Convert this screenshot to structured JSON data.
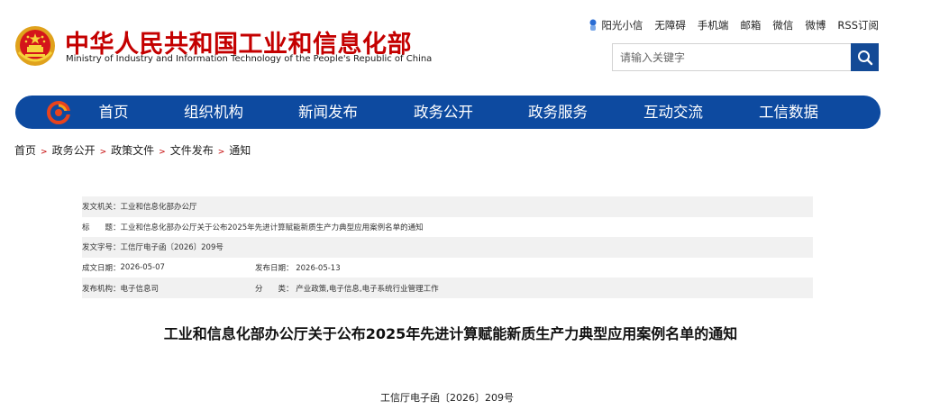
{
  "header": {
    "title_cn": "中华人民共和国工业和信息化部",
    "title_en": "Ministry of Industry and Information Technology of the People's Republic of China",
    "top_links": [
      "阳光小信",
      "无障碍",
      "手机端",
      "邮箱",
      "微信",
      "微博",
      "RSS订阅"
    ],
    "search_placeholder": "请输入关键字"
  },
  "nav": {
    "items": [
      "首页",
      "组织机构",
      "新闻发布",
      "政务公开",
      "政务服务",
      "互动交流",
      "工信数据"
    ],
    "color": "#0d4aa0"
  },
  "breadcrumb": [
    "首页",
    "政务公开",
    "政策文件",
    "文件发布",
    "通知"
  ],
  "info": {
    "issuer_label": "发文机关：",
    "issuer": "工业和信息化部办公厅",
    "title_label": "标　　题：",
    "title": "工业和信息化部办公厅关于公布2025年先进计算赋能新质生产力典型应用案例名单的通知",
    "docno_label": "发文字号：",
    "docno": "工信厅电子函〔2026〕209号",
    "written_label": "成文日期：",
    "written": "2026-05-07",
    "published_label": "发布日期：",
    "published": "2026-05-13",
    "agency_label": "发布机构：",
    "agency": "电子信息司",
    "category_label": "分　　类：",
    "category": "产业政策,电子信息,电子系统行业管理工作"
  },
  "document": {
    "heading": "工业和信息化部办公厅关于公布2025年先进计算赋能新质生产力典型应用案例名单的通知",
    "number": "工信厅电子函〔2026〕209号"
  }
}
